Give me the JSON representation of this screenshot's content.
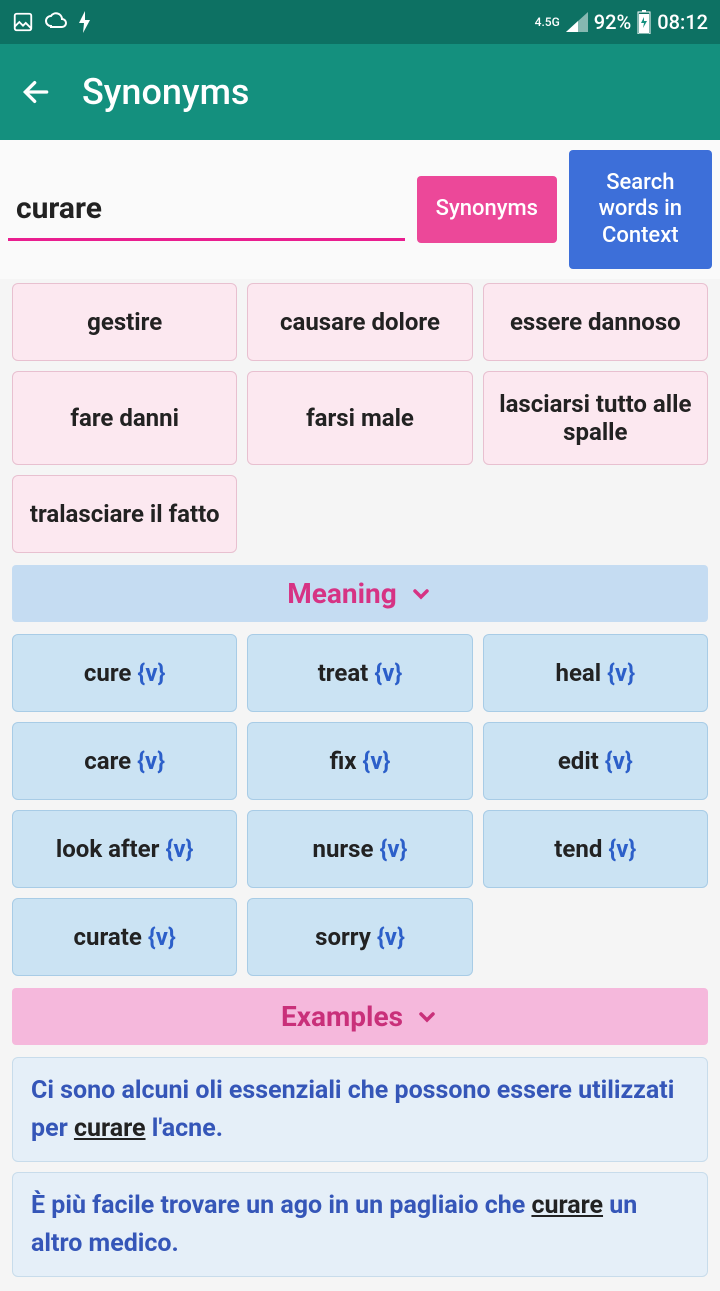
{
  "status": {
    "network": "4.5G",
    "battery": "92%",
    "time": "08:12"
  },
  "appbar": {
    "title": "Synonyms"
  },
  "search": {
    "value": "curare",
    "btn_synonyms": "Synonyms",
    "btn_context": "Search words in Context"
  },
  "antonyms": [
    "gestire",
    "causare dolore",
    "essere dannoso",
    "fare danni",
    "farsi male",
    "lasciarsi tutto alle spalle",
    "tralasciare il fatto"
  ],
  "meaning_label": "Meaning",
  "meanings": [
    "cure",
    "treat",
    "heal",
    "care",
    "fix",
    "edit",
    "look after",
    "nurse",
    "tend",
    "curate",
    "sorry"
  ],
  "verb_tag": "{v}",
  "examples_label": "Examples",
  "examples": [
    {
      "pre": "Ci sono alcuni oli essenziali che possono essere utilizzati per ",
      "kw": "curare",
      "post": " l'acne."
    },
    {
      "pre": "È più facile trovare un ago in un pagliaio che ",
      "kw": "curare",
      "post": " un altro medico."
    }
  ]
}
